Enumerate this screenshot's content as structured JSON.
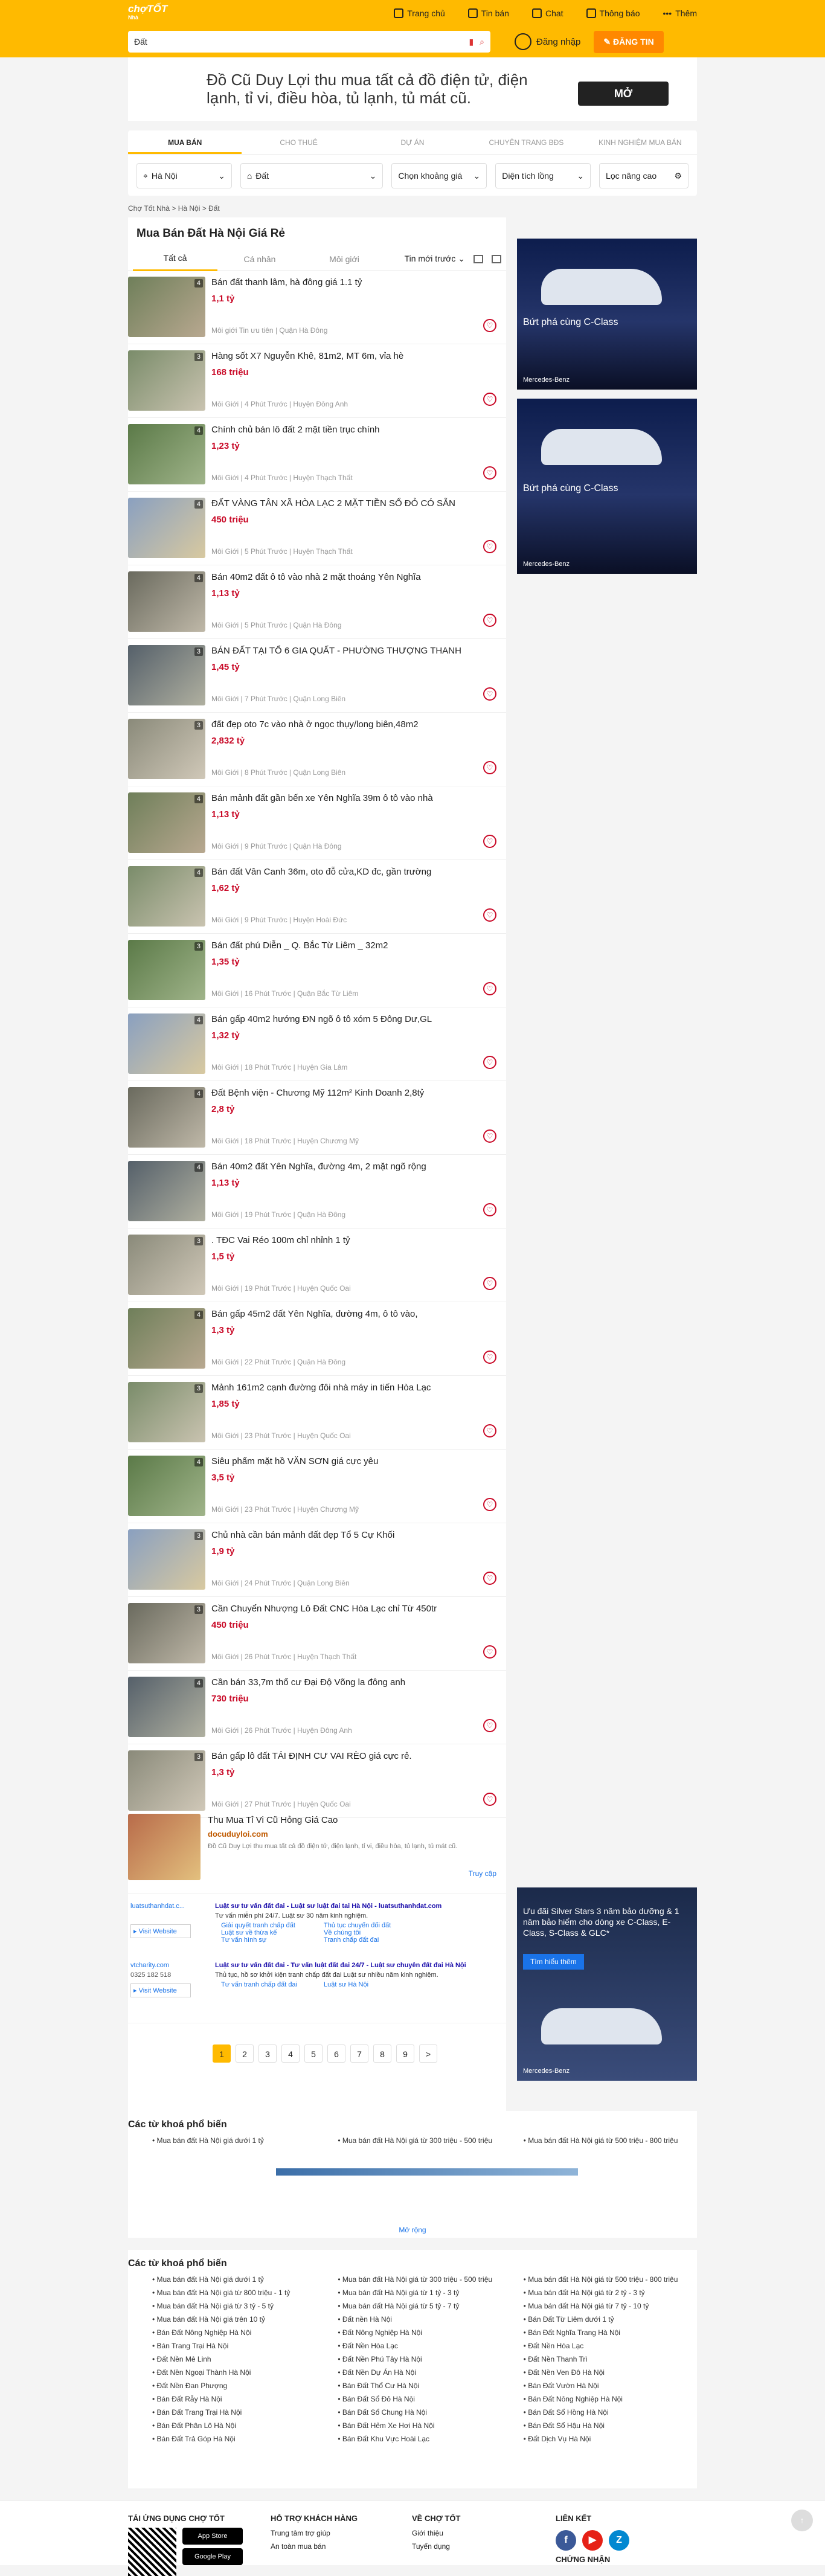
{
  "header": {
    "logo": "chợTỐT",
    "logo_sub": "Nhà",
    "nav": [
      "Trang chủ",
      "Tin bán",
      "Chat",
      "Thông báo",
      "Thêm"
    ],
    "search_value": "Đất",
    "login": "Đăng nhập",
    "post": "ĐĂNG TIN"
  },
  "banner": {
    "text": "Đồ Cũ Duy Lợi thu mua tất cả đồ điện tử, điện lạnh, tỉ vi, điều hòa, tủ lạnh, tủ mát cũ.",
    "button": "MỞ"
  },
  "filters": {
    "tabs": [
      "MUA BÁN",
      "CHO THUÊ",
      "DỰ ÁN",
      "CHUYÊN TRANG BĐS",
      "KINH NGHIỆM MUA BÁN"
    ],
    "location": "Hà Nội",
    "category": "Đất",
    "price": "Chọn khoảng giá",
    "area": "Diện tích lồng",
    "advanced": "Lọc nâng cao"
  },
  "breadcrumb": "Chợ Tốt Nhà  >  Hà Nội  >  Đất",
  "page_title": "Mua Bán Đất Hà Nội Giá Rẻ",
  "list_tabs": [
    "Tất cả",
    "Cá nhân",
    "Môi giới"
  ],
  "sort": "Tin mới trước",
  "listings": [
    {
      "title": "Bán đất thanh lâm, hà đông giá 1.1 tỷ",
      "price": "1,1 tỷ",
      "meta": "Môi giới  Tin ưu tiên | Quận Hà Đông",
      "count": "4"
    },
    {
      "title": "Hàng sốt X7 Nguyễn Khê, 81m2, MT 6m, vỉa hè",
      "price": "168 triệu",
      "meta": "Môi Giới | 4 Phút Trước | Huyện Đông Anh",
      "count": "3"
    },
    {
      "title": "Chính chủ bán lô đất 2 mặt tiền trục chính",
      "price": "1,23 tỷ",
      "meta": "Môi Giới | 4 Phút Trước | Huyện Thạch Thất",
      "count": "4"
    },
    {
      "title": "ĐẤT VÀNG TÂN XÃ HÒA LẠC 2 MẶT TIỀN SỔ ĐỎ CÓ SẴN",
      "price": "450 triệu",
      "meta": "Môi Giới | 5 Phút Trước | Huyện Thạch Thất",
      "count": "4"
    },
    {
      "title": "Bán 40m2 đất ô tô vào nhà 2 mặt thoáng Yên Nghĩa",
      "price": "1,13 tỷ",
      "meta": "Môi Giới | 5 Phút Trước | Quận Hà Đông",
      "count": "4"
    },
    {
      "title": "BÁN ĐẤT TẠI TỔ 6 GIA QUẤT - PHƯỜNG THƯỢNG THANH",
      "price": "1,45 tỷ",
      "meta": "Môi Giới | 7 Phút Trước | Quận Long Biên",
      "count": "3"
    },
    {
      "title": "đất đẹp oto 7c vào nhà ở ngọc thụy/long biên,48m2",
      "price": "2,832 tỷ",
      "meta": "Môi Giới | 8 Phút Trước | Quận Long Biên",
      "count": "3"
    },
    {
      "title": "Bán mảnh đất gần bến xe Yên Nghĩa 39m ô tô vào nhà",
      "price": "1,13 tỷ",
      "meta": "Môi Giới | 9 Phút Trước | Quận Hà Đông",
      "count": "4"
    },
    {
      "title": "Bán đất Vân Canh 36m, oto đỗ cửa,KD đc, gần trường",
      "price": "1,62 tỷ",
      "meta": "Môi Giới | 9 Phút Trước | Huyện Hoài Đức",
      "count": "4"
    },
    {
      "title": "Bán đất phú Diễn _ Q. Bắc Từ Liêm _ 32m2",
      "price": "1,35 tỷ",
      "meta": "Môi Giới | 16 Phút Trước | Quận Bắc Từ Liêm",
      "count": "3"
    },
    {
      "title": "Bán gấp 40m2 hướng ĐN ngõ ô tô xóm 5 Đông Dư,GL",
      "price": "1,32 tỷ",
      "meta": "Môi Giới | 18 Phút Trước | Huyện Gia Lâm",
      "count": "4"
    },
    {
      "title": "Đất Bệnh viện - Chương Mỹ 112m² Kinh Doanh 2,8tỷ",
      "price": "2,8 tỷ",
      "meta": "Môi Giới | 18 Phút Trước | Huyện Chương Mỹ",
      "count": "4"
    },
    {
      "title": "Bán 40m2 đất Yên Nghĩa, đường 4m, 2 mặt ngõ rộng",
      "price": "1,13 tỷ",
      "meta": "Môi Giới | 19 Phút Trước | Quận Hà Đông",
      "count": "4"
    },
    {
      "title": ". TĐC Vai Réo 100m chỉ nhỉnh 1 tỷ",
      "price": "1,5 tỷ",
      "meta": "Môi Giới | 19 Phút Trước | Huyện Quốc Oai",
      "count": "3"
    },
    {
      "title": "Bán gấp 45m2 đất Yên Nghĩa, đường 4m, ô tô vào,",
      "price": "1,3 tỷ",
      "meta": "Môi Giới | 22 Phút Trước | Quận Hà Đông",
      "count": "4"
    },
    {
      "title": "Mảnh 161m2 cạnh đường đôi nhà máy in tiến Hòa Lạc",
      "price": "1,85 tỷ",
      "meta": "Môi Giới | 23 Phút Trước | Huyện Quốc Oai",
      "count": "3"
    },
    {
      "title": "Siêu phẩm mặt hồ VĂN SƠN giá cực yêu",
      "price": "3,5 tỷ",
      "meta": "Môi Giới | 23 Phút Trước | Huyện Chương Mỹ",
      "count": "4"
    },
    {
      "title": "Chủ nhà cần bán mảnh đất đẹp Tổ 5 Cự Khối",
      "price": "1,9 tỷ",
      "meta": "Môi Giới | 24 Phút Trước | Quận Long Biên",
      "count": "3"
    },
    {
      "title": "Cần Chuyển Nhượng Lô Đất CNC Hòa Lạc chỉ Từ 450tr",
      "price": "450 triệu",
      "meta": "Môi Giới | 26 Phút Trước | Huyện Thạch Thất",
      "count": "3"
    },
    {
      "title": "Cần bán 33,7m thổ cư Đại Độ Võng la đông anh",
      "price": "730 triệu",
      "meta": "Môi Giới | 26 Phút Trước | Huyện Đông Anh",
      "count": "4"
    },
    {
      "title": "Bán gấp lô đất TÁI ĐỊNH CƯ VAI RÈO giá cực rẻ.",
      "price": "1,3 tỷ",
      "meta": "Môi Giới | 27 Phút Trước | Huyện Quốc Oai",
      "count": "3"
    }
  ],
  "ad_inline": {
    "title": "Thu Mua Tỉ Vi Cũ Hỏng Giá Cao",
    "domain": "docuduyloi.com",
    "desc": "Đồ Cũ Duy Lợi thu mua tất cả đồ điện tử, điện lạnh, tỉ vi, điều hòa, tủ lạnh, tủ mát cũ.",
    "link": "Truy cập"
  },
  "ad_law": [
    {
      "site": "luatsuthanhdat.c...",
      "title": "Luật sư tư vấn đất đai - Luật sư luật đai tai Hà Nội - luatsuthanhdat.com",
      "line": "Tư vấn miễn phí 24/7. Luật sư 30 năm kinh nghiệm.",
      "links": [
        "Giải quyết tranh chấp đất",
        "Thủ tục chuyển đổi đất",
        "Luật sư về thừa kế",
        "Về chúng tôi",
        "Tư vấn hình sự",
        "Tranh chấp đất đai"
      ],
      "visit": "Visit Website"
    },
    {
      "site": "vtcharity.com",
      "title": "Luật sư tư vấn đất đai - Tư vấn luật đất đai 24/7 - Luật sư chuyên đất đai Hà Nội",
      "line": "Thủ tục, hồ sơ khởi kiện tranh chấp đất đai Luật sư nhiều năm kinh nghiệm.",
      "links": [
        "Tư vấn tranh chấp đất đai",
        "Luật sư Hà Nội"
      ],
      "phone": "0325 182 518",
      "visit": "Visit Website"
    }
  ],
  "pages": [
    "1",
    "2",
    "3",
    "4",
    "5",
    "6",
    "7",
    "8",
    "9",
    ">"
  ],
  "right_ads": [
    {
      "text": "Bứt phá cùng C-Class",
      "brand": "Mercedes-Benz"
    },
    {
      "text": "Bứt phá cùng C-Class",
      "brand": "Mercedes-Benz"
    },
    {
      "text": "Ưu đãi Silver Stars 3 năm bảo dưỡng & 1 năm bảo hiểm cho dòng xe C-Class, E-Class, S-Class & GLC*",
      "btn": "Tìm hiểu thêm",
      "brand": "Mercedes-Benz"
    }
  ],
  "popular_title": "Các từ khoá phổ biến",
  "popular_short": [
    "Mua bán đất Hà Nội giá dưới 1 tỷ",
    "Mua bán đất Hà Nội giá từ 300 triệu - 500 triệu",
    "Mua bán đất Hà Nội giá từ 500 triệu - 800 triệu"
  ],
  "more": "Mở rộng",
  "popular_long": [
    "Mua bán đất Hà Nội giá dưới 1 tỷ",
    "Mua bán đất Hà Nội giá từ 300 triệu - 500 triệu",
    "Mua bán đất Hà Nội giá từ 500 triệu - 800 triệu",
    "Mua bán đất Hà Nội giá từ 800 triệu - 1 tỷ",
    "Mua bán đất Hà Nội giá từ 1 tỷ - 3 tỷ",
    "Mua bán đất Hà Nội giá từ 2 tỷ - 3 tỷ",
    "Mua bán đất Hà Nội giá từ 3 tỷ - 5 tỷ",
    "Mua bán đất Hà Nội giá từ 5 tỷ - 7 tỷ",
    "Mua bán đất Hà Nội giá từ 7 tỷ - 10 tỷ",
    "Mua bán đất Hà Nội giá trên 10 tỷ",
    "Đất nền Hà Nội",
    "Bán Đất Từ Liêm dưới 1 tỷ",
    "Bán Đất Nông Nghiệp Hà Nội",
    "Đất Nông Nghiệp Hà Nội",
    "Bán Đất Nghĩa Trang Hà Nội",
    "Bán Trang Trại Hà Nội",
    "Đất Nền Hòa Lạc",
    "Đất Nền Hòa Lạc",
    "Đất Nền Mê Linh",
    "Đất Nền Phú Tây Hà Nội",
    "Đất Nền Thanh Trì",
    "Đất Nền Ngoại Thành Hà Nội",
    "Đất Nền Dự Án Hà Nội",
    "Đất Nền Ven Đô Hà Nội",
    "Đất Nền Đan Phượng",
    "Bán Đất Thổ Cư Hà Nội",
    "Bán Đất Vườn Hà Nội",
    "Bán Đất Rẫy Hà Nội",
    "Bán Đất Sổ Đỏ Hà Nội",
    "Bán Đất Nông Nghiệp Hà Nội",
    "Bán Đất Trang Trại Hà Nội",
    "Bán Đất Sổ Chung Hà Nội",
    "Bán Đất Sổ Hồng Hà Nội",
    "Bán Đất Phân Lô Hà Nội",
    "Bán Đất Hẻm Xe Hơi Hà Nội",
    "Bán Đất Sổ Hậu Hà Nội",
    "Bán Đất Trả Góp Hà Nội",
    "Bán Đất Khu Vực Hoài Lạc",
    "Đất Dịch Vụ Hà Nội"
  ],
  "footer": {
    "col1": "TẢI ỨNG DỤNG CHỢ TỐT",
    "app_store": "App Store",
    "google_play": "Google Play",
    "col2": "HỖ TRỢ KHÁCH HÀNG",
    "col2_items": [
      "Trung tâm trợ giúp",
      "An toàn mua bán"
    ],
    "col3": "VỀ CHỢ TỐT",
    "col3_items": [
      "Giới thiệu",
      "Tuyển dụng"
    ],
    "col4": "LIÊN KẾT",
    "col4_sub": "CHỨNG NHẬN"
  }
}
